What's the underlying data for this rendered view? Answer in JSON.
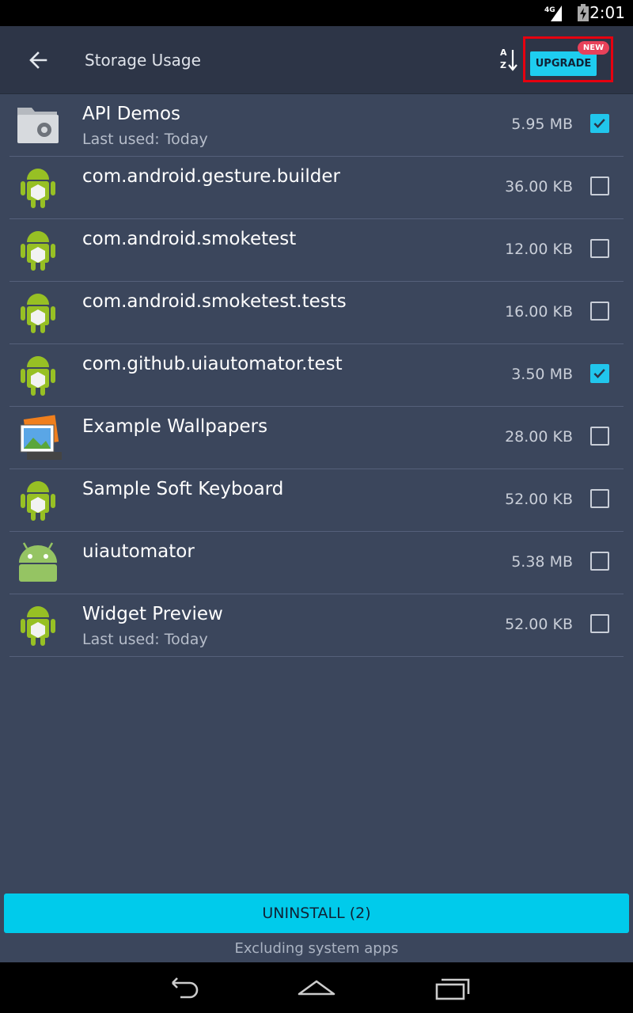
{
  "status": {
    "network_label": "4G",
    "time": "2:01"
  },
  "appbar": {
    "title": "Storage Usage",
    "sort_icon": "sort-az-icon",
    "upgrade_label": "UPGRADE",
    "new_badge": "NEW",
    "upgrade_accent": "#1ecdf0",
    "highlight_color": "#e6000f"
  },
  "apps": [
    {
      "name": "API Demos",
      "sub": "Last used: Today",
      "size": "5.95 MB",
      "checked": true,
      "icon": "folder-gear-icon"
    },
    {
      "name": "com.android.gesture.builder",
      "sub": "",
      "size": "36.00 KB",
      "checked": false,
      "icon": "android-package-icon"
    },
    {
      "name": "com.android.smoketest",
      "sub": "",
      "size": "12.00 KB",
      "checked": false,
      "icon": "android-package-icon"
    },
    {
      "name": "com.android.smoketest.tests",
      "sub": "",
      "size": "16.00 KB",
      "checked": false,
      "icon": "android-package-icon"
    },
    {
      "name": "com.github.uiautomator.test",
      "sub": "",
      "size": "3.50 MB",
      "checked": true,
      "icon": "android-package-icon"
    },
    {
      "name": "Example Wallpapers",
      "sub": "",
      "size": "28.00 KB",
      "checked": false,
      "icon": "wallpaper-photos-icon"
    },
    {
      "name": "Sample Soft Keyboard",
      "sub": "",
      "size": "52.00 KB",
      "checked": false,
      "icon": "android-package-icon"
    },
    {
      "name": "uiautomator",
      "sub": "",
      "size": "5.38 MB",
      "checked": false,
      "icon": "android-head-icon"
    },
    {
      "name": "Widget Preview",
      "sub": "Last used: Today",
      "size": "52.00 KB",
      "checked": false,
      "icon": "android-package-icon"
    }
  ],
  "bottom": {
    "uninstall_label": "UNINSTALL (2)",
    "footnote": "Excluding system apps"
  },
  "colors": {
    "background": "#3b465c",
    "appbar": "#2d3547",
    "checked": "#21c6ec"
  }
}
